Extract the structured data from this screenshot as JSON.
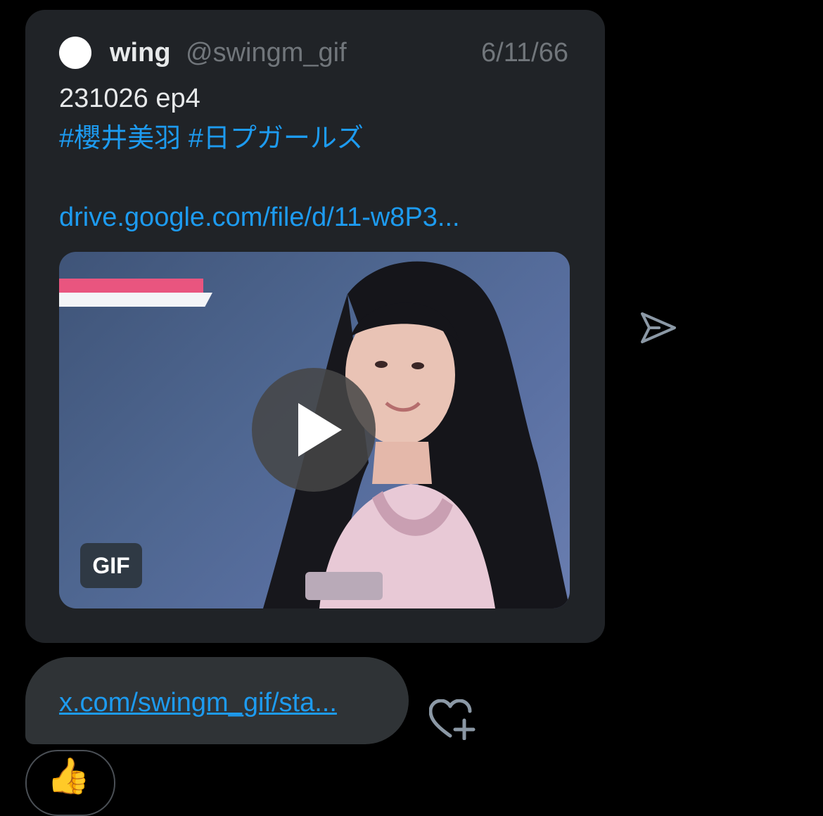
{
  "tweet": {
    "author_name": "wing",
    "author_handle": "@swingm_gif",
    "date": "6/11/66",
    "text_line1": "231026 ep4",
    "hashtags": "#櫻井美羽 #日プガールズ",
    "link": "drive.google.com/file/d/11-w8P3...",
    "media_badge": "GIF"
  },
  "message": {
    "link": "x.com/swingm_gif/sta..."
  },
  "reaction": {
    "emoji": "👍"
  },
  "icons": {
    "send": "send-icon",
    "add_reaction": "heart-plus-icon",
    "play": "play-icon"
  },
  "colors": {
    "background": "#000000",
    "card": "#202327",
    "bubble": "#2f3336",
    "link": "#1d9bf0",
    "muted": "#71767b"
  }
}
